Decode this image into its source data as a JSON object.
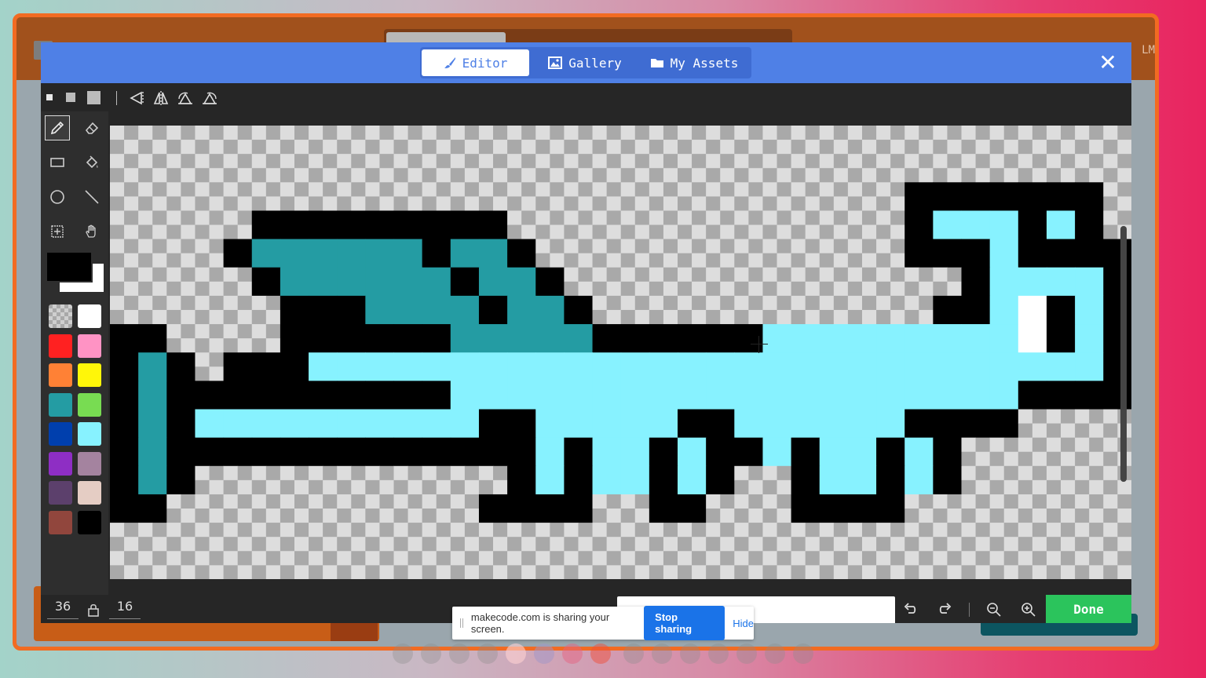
{
  "background": {
    "corner_label": "LM"
  },
  "header": {
    "tabs": [
      {
        "label": "Editor",
        "icon": "paintbrush-icon",
        "active": true
      },
      {
        "label": "Gallery",
        "icon": "image-icon",
        "active": false
      },
      {
        "label": "My Assets",
        "icon": "folder-icon",
        "active": false
      }
    ],
    "close_icon": "close-icon"
  },
  "toolbar": {
    "brush_sizes": [
      "small",
      "medium",
      "large"
    ],
    "symmetry_tools": [
      "flip-horizontal-icon",
      "flip-vertical-icon",
      "rotate-counterclockwise-icon",
      "rotate-clockwise-icon"
    ]
  },
  "tools": [
    {
      "name": "pencil",
      "icon": "pencil-icon",
      "active": true
    },
    {
      "name": "eraser",
      "icon": "eraser-icon",
      "active": false
    },
    {
      "name": "rectangle",
      "icon": "rectangle-icon",
      "active": false
    },
    {
      "name": "fill",
      "icon": "paint-bucket-icon",
      "active": false
    },
    {
      "name": "circle",
      "icon": "circle-icon",
      "active": false
    },
    {
      "name": "line",
      "icon": "line-icon",
      "active": false
    },
    {
      "name": "marquee",
      "icon": "marquee-icon",
      "active": false
    },
    {
      "name": "pan",
      "icon": "hand-icon",
      "active": false
    }
  ],
  "colors": {
    "primary": "#000000",
    "secondary": "#ffffff",
    "palette": [
      "transparent",
      "#ffffff",
      "#ff2121",
      "#ff93c4",
      "#ff8135",
      "#fff609",
      "#249ca3",
      "#78dc52",
      "#003fad",
      "#87f2ff",
      "#8e2ec4",
      "#a4839f",
      "#5c406c",
      "#e5cdc4",
      "#91463d",
      "#000000"
    ]
  },
  "sprite": {
    "width": 36,
    "height": 16,
    "rows": [
      "....................................",
      "....................................",
      "............................KKKKKKK.",
      ".....KKKKKKKKK..............KLLLKLK.",
      "....KTTTTTTKTTK.............KKKLKKKK",
      ".....KTTTTTTKTTK..............KLLLLK",
      "......KKKTTTTKTTK............KKLWKLK",
      "KK....KKKKKKTTTTTKKKKKKLLLLLLLLLWKLK",
      "KTK.KKKLLLLLLLLLLLLLLLLLLLLLLLLLLLLK",
      "KTKKKKKKKKKKLLLLLLLLLLLLLLLLLLLLKKKK",
      "KTKLLLLLLLLLLKKLLLLLKKLLLLLLKKKK....",
      "KTKKKKKKKKKKKKKLKLLKLKKLKLLKLK......",
      "KTK...........KLKLLKLK..KLLKLK......",
      "KK...........KKKK..KK...KKKK........",
      "....................................",
      "...................................."
    ]
  },
  "bottom": {
    "width_value": "36",
    "height_value": "16",
    "name_placeholder": "",
    "done_label": "Done"
  },
  "share_notice": {
    "message": "makecode.com is sharing your screen.",
    "stop_label": "Stop sharing",
    "hide_label": "Hide"
  }
}
